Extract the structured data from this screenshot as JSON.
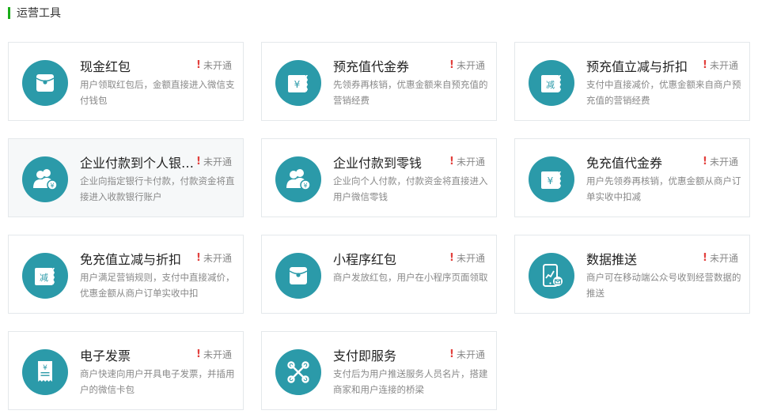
{
  "section": {
    "title": "运营工具"
  },
  "colors": {
    "icon_bg": "#2b9aa9",
    "status_mark": "#e2403d",
    "accent": "#1aad19"
  },
  "cards": [
    {
      "title": "现金红包",
      "status": "未开通",
      "icon": "red-packet-icon",
      "desc": "用户领取红包后，金额直接进入微信支付钱包"
    },
    {
      "title": "预充值代金券",
      "status": "未开通",
      "icon": "voucher-icon",
      "desc": "先领券再核销，优惠金额来自预充值的营销经费"
    },
    {
      "title": "预充值立减与折扣",
      "status": "未开通",
      "icon": "discount-icon",
      "desc": "支付中直接减价，优惠金额来自商户预充值的营销经费"
    },
    {
      "title": "企业付款到个人银行卡",
      "status": "未开通",
      "icon": "users-pay-icon",
      "desc": "企业向指定银行卡付款，付款资金将直接进入收款银行账户"
    },
    {
      "title": "企业付款到零钱",
      "status": "未开通",
      "icon": "users-pay-icon",
      "desc": "企业向个人付款，付款资金将直接进入用户微信零钱"
    },
    {
      "title": "免充值代金券",
      "status": "未开通",
      "icon": "voucher-icon",
      "desc": "用户先领券再核销，优惠金额从商户订单实收中扣减"
    },
    {
      "title": "免充值立减与折扣",
      "status": "未开通",
      "icon": "discount-icon",
      "desc": "用户满足营销规则，支付中直接减价，优惠金额从商户订单实收中扣"
    },
    {
      "title": "小程序红包",
      "status": "未开通",
      "icon": "red-packet-icon",
      "desc": "商户发放红包，用户在小程序页面领取"
    },
    {
      "title": "数据推送",
      "status": "未开通",
      "icon": "data-push-icon",
      "desc": "商户可在移动端公众号收到经营数据的推送"
    },
    {
      "title": "电子发票",
      "status": "未开通",
      "icon": "invoice-icon",
      "desc": "商户快速向用户开具电子发票，并插用户的微信卡包"
    },
    {
      "title": "支付即服务",
      "status": "未开通",
      "icon": "service-link-icon",
      "desc": "支付后为用户推送服务人员名片，搭建商家和用户连接的桥梁"
    }
  ],
  "icon_text": {
    "yuan": "¥",
    "jian": "减"
  }
}
